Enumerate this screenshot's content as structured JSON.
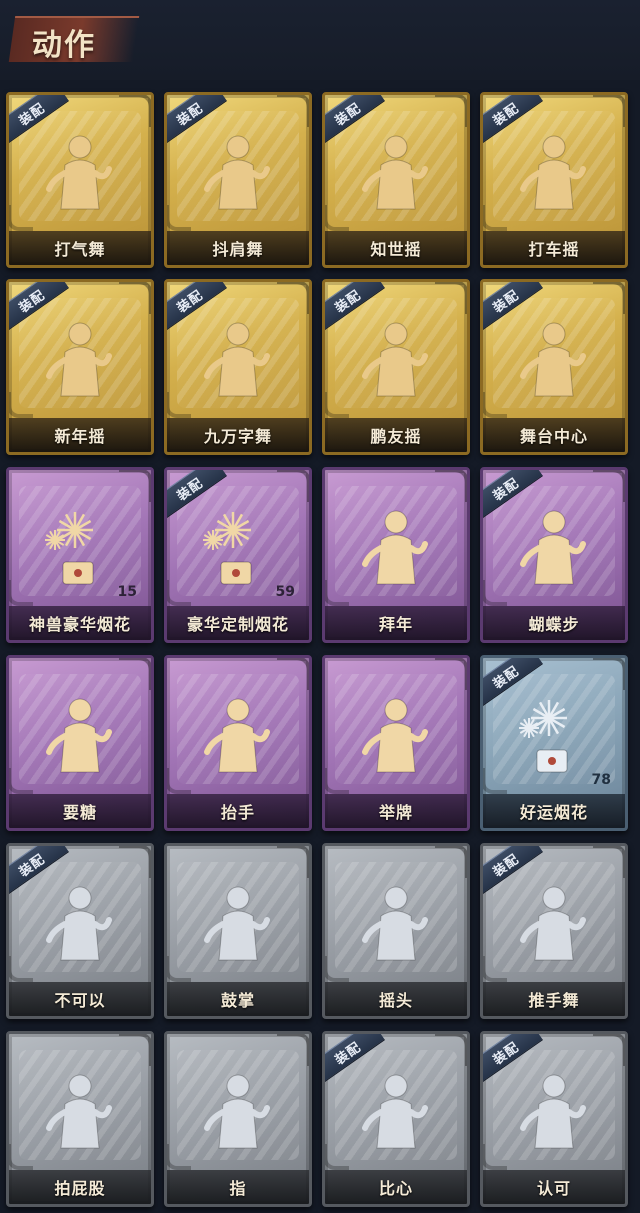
{
  "header": {
    "title": "动作"
  },
  "equip_label": "装配",
  "cards": [
    {
      "label": "打气舞",
      "rarity": "gold",
      "equipped": true,
      "icon": "dancer-music-icon",
      "count": ""
    },
    {
      "label": "抖肩舞",
      "rarity": "gold",
      "equipped": true,
      "icon": "shoulder-shake-icon",
      "count": ""
    },
    {
      "label": "知世摇",
      "rarity": "gold",
      "equipped": true,
      "icon": "sway-music-icon",
      "count": ""
    },
    {
      "label": "打车摇",
      "rarity": "gold",
      "equipped": true,
      "icon": "arm-wave-icon",
      "count": ""
    },
    {
      "label": "新年摇",
      "rarity": "gold",
      "equipped": true,
      "icon": "new-year-sway-icon",
      "count": ""
    },
    {
      "label": "九万字舞",
      "rarity": "gold",
      "equipped": true,
      "icon": "twirl-dance-icon",
      "count": ""
    },
    {
      "label": "鹏友摇",
      "rarity": "gold",
      "equipped": true,
      "icon": "wing-sway-icon",
      "count": ""
    },
    {
      "label": "舞台中心",
      "rarity": "gold",
      "equipped": true,
      "icon": "center-stage-icon",
      "count": ""
    },
    {
      "label": "神兽豪华烟花",
      "rarity": "purple",
      "equipped": false,
      "icon": "fireworks-box-icon",
      "count": "15"
    },
    {
      "label": "豪华定制烟花",
      "rarity": "purple",
      "equipped": true,
      "icon": "fireworks-gift-icon",
      "count": "59"
    },
    {
      "label": "拜年",
      "rarity": "purple",
      "equipped": false,
      "icon": "bow-greeting-icon",
      "count": ""
    },
    {
      "label": "蝴蝶步",
      "rarity": "purple",
      "equipped": true,
      "icon": "butterfly-step-icon",
      "count": ""
    },
    {
      "label": "要糖",
      "rarity": "purple",
      "equipped": false,
      "icon": "ask-candy-icon",
      "count": ""
    },
    {
      "label": "抬手",
      "rarity": "purple",
      "equipped": false,
      "icon": "raise-hand-icon",
      "count": ""
    },
    {
      "label": "举牌",
      "rarity": "purple",
      "equipped": false,
      "icon": "hold-sign-icon",
      "count": ""
    },
    {
      "label": "好运烟花",
      "rarity": "blue",
      "equipped": true,
      "icon": "lucky-firework-icon",
      "count": "78"
    },
    {
      "label": "不可以",
      "rarity": "gray",
      "equipped": true,
      "icon": "finger-wag-icon",
      "count": ""
    },
    {
      "label": "鼓掌",
      "rarity": "gray",
      "equipped": false,
      "icon": "clap-icon",
      "count": ""
    },
    {
      "label": "摇头",
      "rarity": "gray",
      "equipped": false,
      "icon": "head-shake-icon",
      "count": ""
    },
    {
      "label": "推手舞",
      "rarity": "gray",
      "equipped": true,
      "icon": "push-dance-icon",
      "count": ""
    },
    {
      "label": "拍屁股",
      "rarity": "gray",
      "equipped": false,
      "icon": "butt-pat-icon",
      "count": ""
    },
    {
      "label": "指",
      "rarity": "gray",
      "equipped": false,
      "icon": "point-icon",
      "count": ""
    },
    {
      "label": "比心",
      "rarity": "gray",
      "equipped": true,
      "icon": "finger-heart-icon",
      "count": ""
    },
    {
      "label": "认可",
      "rarity": "gray",
      "equipped": true,
      "icon": "thumbs-up-icon",
      "count": ""
    }
  ]
}
